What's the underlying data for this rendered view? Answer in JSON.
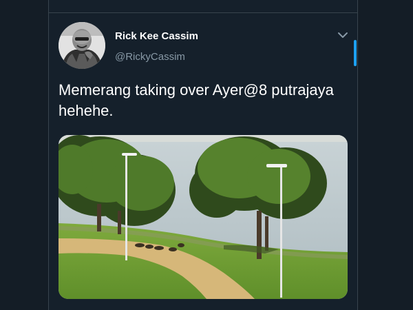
{
  "tweet": {
    "author_name": "Rick Kee Cassim",
    "author_handle": "@RickyCassim",
    "text": "Memerang taking over Ayer@8 putrajaya hehehe.",
    "media_description_icon": "photo"
  },
  "icons": {
    "more": "chevron-down-icon"
  },
  "colors": {
    "background": "#15202b",
    "accent": "#1da1f2",
    "secondary_text": "#8899a6"
  }
}
